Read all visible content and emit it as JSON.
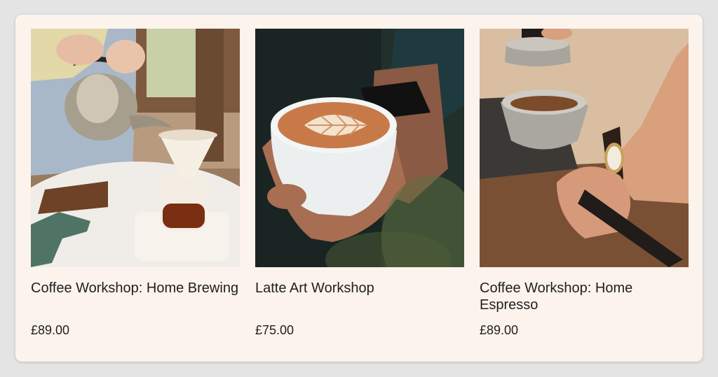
{
  "products": [
    {
      "image_desc": "pour-over coffee",
      "name": "Coffee Workshop: Home Brewing",
      "price": "£89.00"
    },
    {
      "image_desc": "latte art cup",
      "name": "Latte Art Workshop",
      "price": "£75.00"
    },
    {
      "image_desc": "espresso tamping",
      "name": "Coffee Workshop: Home Espresso",
      "price": "£89.00"
    }
  ],
  "colors": {
    "card_background": "#fcf3ec",
    "page_background": "#e4e4e4",
    "text": "#1f1f1f"
  }
}
